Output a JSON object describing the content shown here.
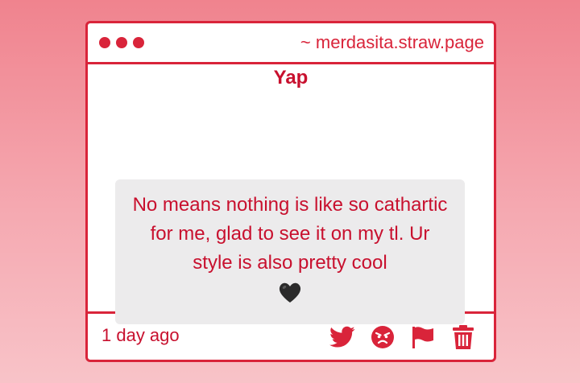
{
  "window": {
    "url_label": "~ merdasita.straw.page"
  },
  "post": {
    "heading": "Yap",
    "message": "No means nothing is like so cathartic for me, glad to see it on my tl. Ur style is also pretty cool",
    "emoji": "black-heart",
    "timestamp": "1 day ago"
  },
  "actions": [
    {
      "name": "twitter-share",
      "icon": "twitter-bird-icon"
    },
    {
      "name": "react-angry",
      "icon": "angry-face-icon"
    },
    {
      "name": "report-flag",
      "icon": "flag-icon"
    },
    {
      "name": "delete",
      "icon": "trash-icon"
    }
  ],
  "colors": {
    "accent": "#d9243a",
    "text": "#c8102e",
    "message_bg": "#ecebec",
    "bg_top": "#f0838e",
    "bg_bottom": "#f8c3c8"
  }
}
